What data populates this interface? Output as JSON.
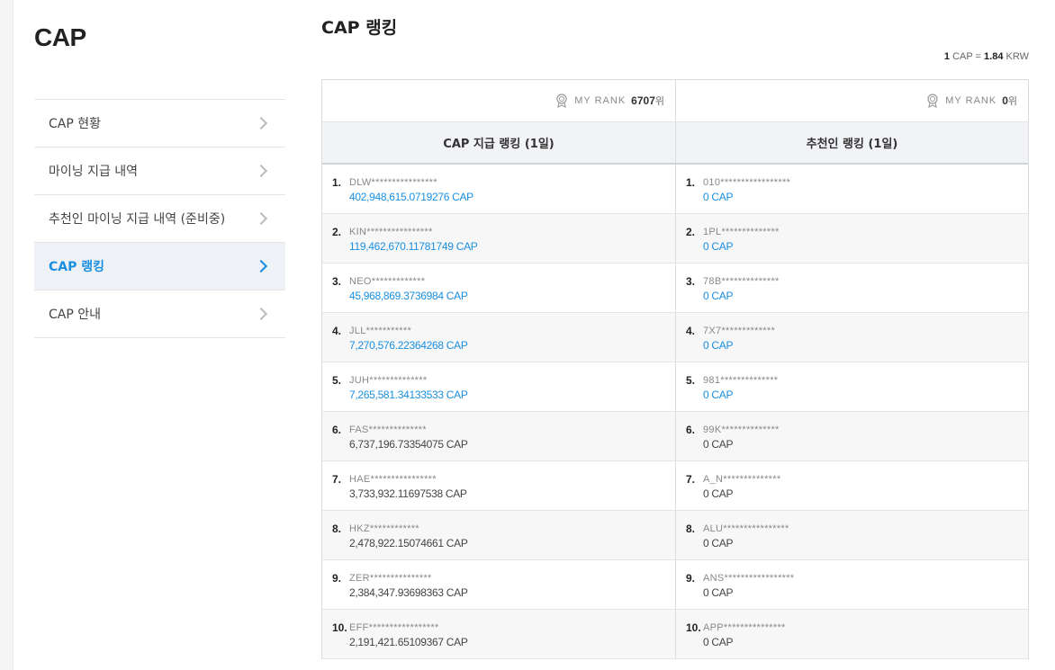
{
  "sidebar": {
    "title": "CAP",
    "items": [
      {
        "label": "CAP 현황"
      },
      {
        "label": "마이닝 지급 내역"
      },
      {
        "label": "추천인 마이닝 지급 내역 (준비중)"
      },
      {
        "label": "CAP 랭킹"
      },
      {
        "label": "CAP 안내"
      }
    ]
  },
  "main": {
    "title": "CAP 랭킹",
    "rate": {
      "cap_amount": "1",
      "cap_unit": "CAP =",
      "krw_amount": "1.84",
      "krw_unit": "KRW"
    }
  },
  "rank_table": {
    "left": {
      "my_rank_label": "MY RANK",
      "my_rank_value": "6707",
      "my_rank_suffix": "위",
      "header": "CAP 지급 랭킹 (1일)",
      "rows": [
        {
          "no": "1.",
          "id": "DLW****************",
          "amount": "402,948,615.0719276 CAP",
          "highlight": true
        },
        {
          "no": "2.",
          "id": "KIN****************",
          "amount": "119,462,670.11781749 CAP",
          "highlight": true
        },
        {
          "no": "3.",
          "id": "NEO*************",
          "amount": "45,968,869.3736984 CAP",
          "highlight": true
        },
        {
          "no": "4.",
          "id": "JLL***********",
          "amount": "7,270,576.22364268 CAP",
          "highlight": true
        },
        {
          "no": "5.",
          "id": "JUH**************",
          "amount": "7,265,581.34133533 CAP",
          "highlight": true
        },
        {
          "no": "6.",
          "id": "FAS**************",
          "amount": "6,737,196.73354075 CAP",
          "highlight": false
        },
        {
          "no": "7.",
          "id": "HAE****************",
          "amount": "3,733,932.11697538 CAP",
          "highlight": false
        },
        {
          "no": "8.",
          "id": "HKZ************",
          "amount": "2,478,922.15074661 CAP",
          "highlight": false
        },
        {
          "no": "9.",
          "id": "ZER***************",
          "amount": "2,384,347.93698363 CAP",
          "highlight": false
        },
        {
          "no": "10.",
          "id": "EFF*****************",
          "amount": "2,191,421.65109367 CAP",
          "highlight": false
        }
      ]
    },
    "right": {
      "my_rank_label": "MY RANK",
      "my_rank_value": "0",
      "my_rank_suffix": "위",
      "header": "추천인 랭킹 (1일)",
      "rows": [
        {
          "no": "1.",
          "id": "010*****************",
          "amount": "0 CAP",
          "highlight": true
        },
        {
          "no": "2.",
          "id": "1PL**************",
          "amount": "0 CAP",
          "highlight": true
        },
        {
          "no": "3.",
          "id": "78B**************",
          "amount": "0 CAP",
          "highlight": true
        },
        {
          "no": "4.",
          "id": "7X7*************",
          "amount": "0 CAP",
          "highlight": true
        },
        {
          "no": "5.",
          "id": "981**************",
          "amount": "0 CAP",
          "highlight": true
        },
        {
          "no": "6.",
          "id": "99K**************",
          "amount": "0 CAP",
          "highlight": false
        },
        {
          "no": "7.",
          "id": "A_N**************",
          "amount": "0 CAP",
          "highlight": false
        },
        {
          "no": "8.",
          "id": "ALU****************",
          "amount": "0 CAP",
          "highlight": false
        },
        {
          "no": "9.",
          "id": "ANS*****************",
          "amount": "0 CAP",
          "highlight": false
        },
        {
          "no": "10.",
          "id": "APP***************",
          "amount": "0 CAP",
          "highlight": false
        }
      ]
    }
  },
  "colors": {
    "accent": "#1a8fe0",
    "header_bg": "#f1f3f6",
    "active_menu_bg": "#eef1f5"
  },
  "icons": {
    "my_rank": "medal-icon",
    "menu_arrow": "chevron-right-icon"
  }
}
